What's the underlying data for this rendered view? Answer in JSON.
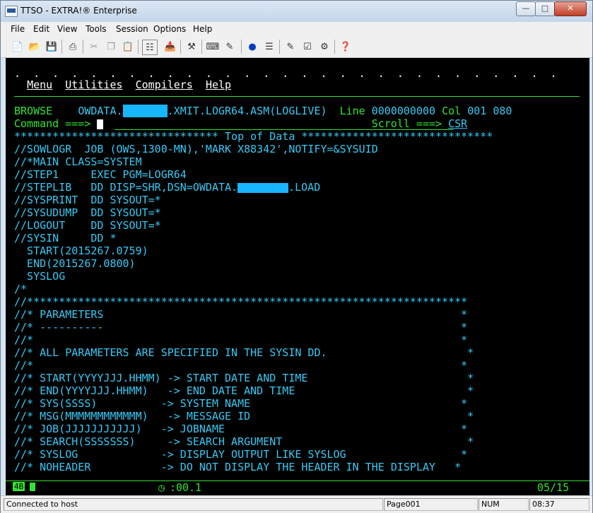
{
  "window": {
    "title": "TTSO - EXTRA!® Enterprise",
    "minimize_icon": "minimize-icon",
    "maximize_icon": "maximize-icon",
    "close_icon": "close-icon"
  },
  "menubar": {
    "items": [
      "File",
      "Edit",
      "View",
      "Tools",
      "Session",
      "Options",
      "Help"
    ]
  },
  "toolbar": {
    "buttons": [
      "new-icon",
      "open-icon",
      "save-icon",
      "print-icon",
      "cut-icon",
      "copy-icon",
      "paste-icon",
      "send-icon",
      "receive-icon",
      "macro-icon",
      "transfer-icon",
      "edit-icon",
      "record-icon",
      "keyboard-icon",
      "quickpad-icon",
      "properties-icon",
      "settings-icon",
      "help-icon"
    ]
  },
  "terminal": {
    "dots": ".  .  .  .  .  .  .  .  .  .  .  .  .  .  .  .  .  .  .  .  .  .  .  .  .  .  .  .  .",
    "menu_items": [
      "Menu",
      "Utilities",
      "Compilers",
      "Help"
    ],
    "browse_label": "BROWSE",
    "dataset_prefix": "OWDATA.",
    "dataset_suffix": ".XMIT.LOGR64.ASM(LOGLIVE)",
    "line_label": "Line",
    "line_value": "0000000000",
    "col_label": "Col",
    "col_value": "001 080",
    "command_label": "Command ===>",
    "scroll_label": "Scroll ===>",
    "scroll_value": "CSR",
    "top_of_data": "******************************** Top of Data ******************************",
    "lines": [
      "//SOWLOGR  JOB (OWS,1300-MN),'MARK X88342',NOTIFY=&SYSUID",
      "//*MAIN CLASS=SYSTEM",
      "//STEP1     EXEC PGM=LOGR64",
      "//SYSPRINT  DD SYSOUT=*",
      "//SYSUDUMP  DD SYSOUT=*",
      "//LOGOUT    DD SYSOUT=*",
      "//SYSIN     DD *",
      "  START(2015267.0759)",
      "  END(2015267.0800)",
      "  SYSLOG",
      "/*",
      "//*********************************************************************",
      "//* PARAMETERS                                                        *",
      "//* ----------                                                        *",
      "//*                                                                   *",
      "//* ALL PARAMETERS ARE SPECIFIED IN THE SYSIN DD.                      *",
      "//*                                                                   *",
      "//* START(YYYYJJJ.HHMM) -> START DATE AND TIME                         *",
      "//* END(YYYYJJJ.HHMM)   -> END DATE AND TIME                           *",
      "//* SYS(SSSS)          -> SYSTEM NAME                                 *",
      "//* MSG(MMMMMMMMMMMM)   -> MESSAGE ID                                  *",
      "//* JOB(JJJJJJJJJJJ)   -> JOBNAME                                     *",
      "//* SEARCH(SSSSSSS)     -> SEARCH ARGUMENT                             *",
      "//* SYSLOG             -> DISPLAY OUTPUT LIKE SYSLOG                  *",
      "//* NOHEADER           -> DO NOT DISPLAY THE HEADER IN THE DISPLAY   *"
    ],
    "steplib_prefix": "//STEPLIB   DD DISP=SHR,DSN=OWDATA.",
    "steplib_suffix": ".LOAD"
  },
  "oia": {
    "session_indicator": "4B",
    "timer": ":00.1",
    "cursor_pos": "05/15"
  },
  "statusbar": {
    "connection": "Connected to host",
    "page": "Page001",
    "num": "NUM",
    "time": "08:37"
  }
}
